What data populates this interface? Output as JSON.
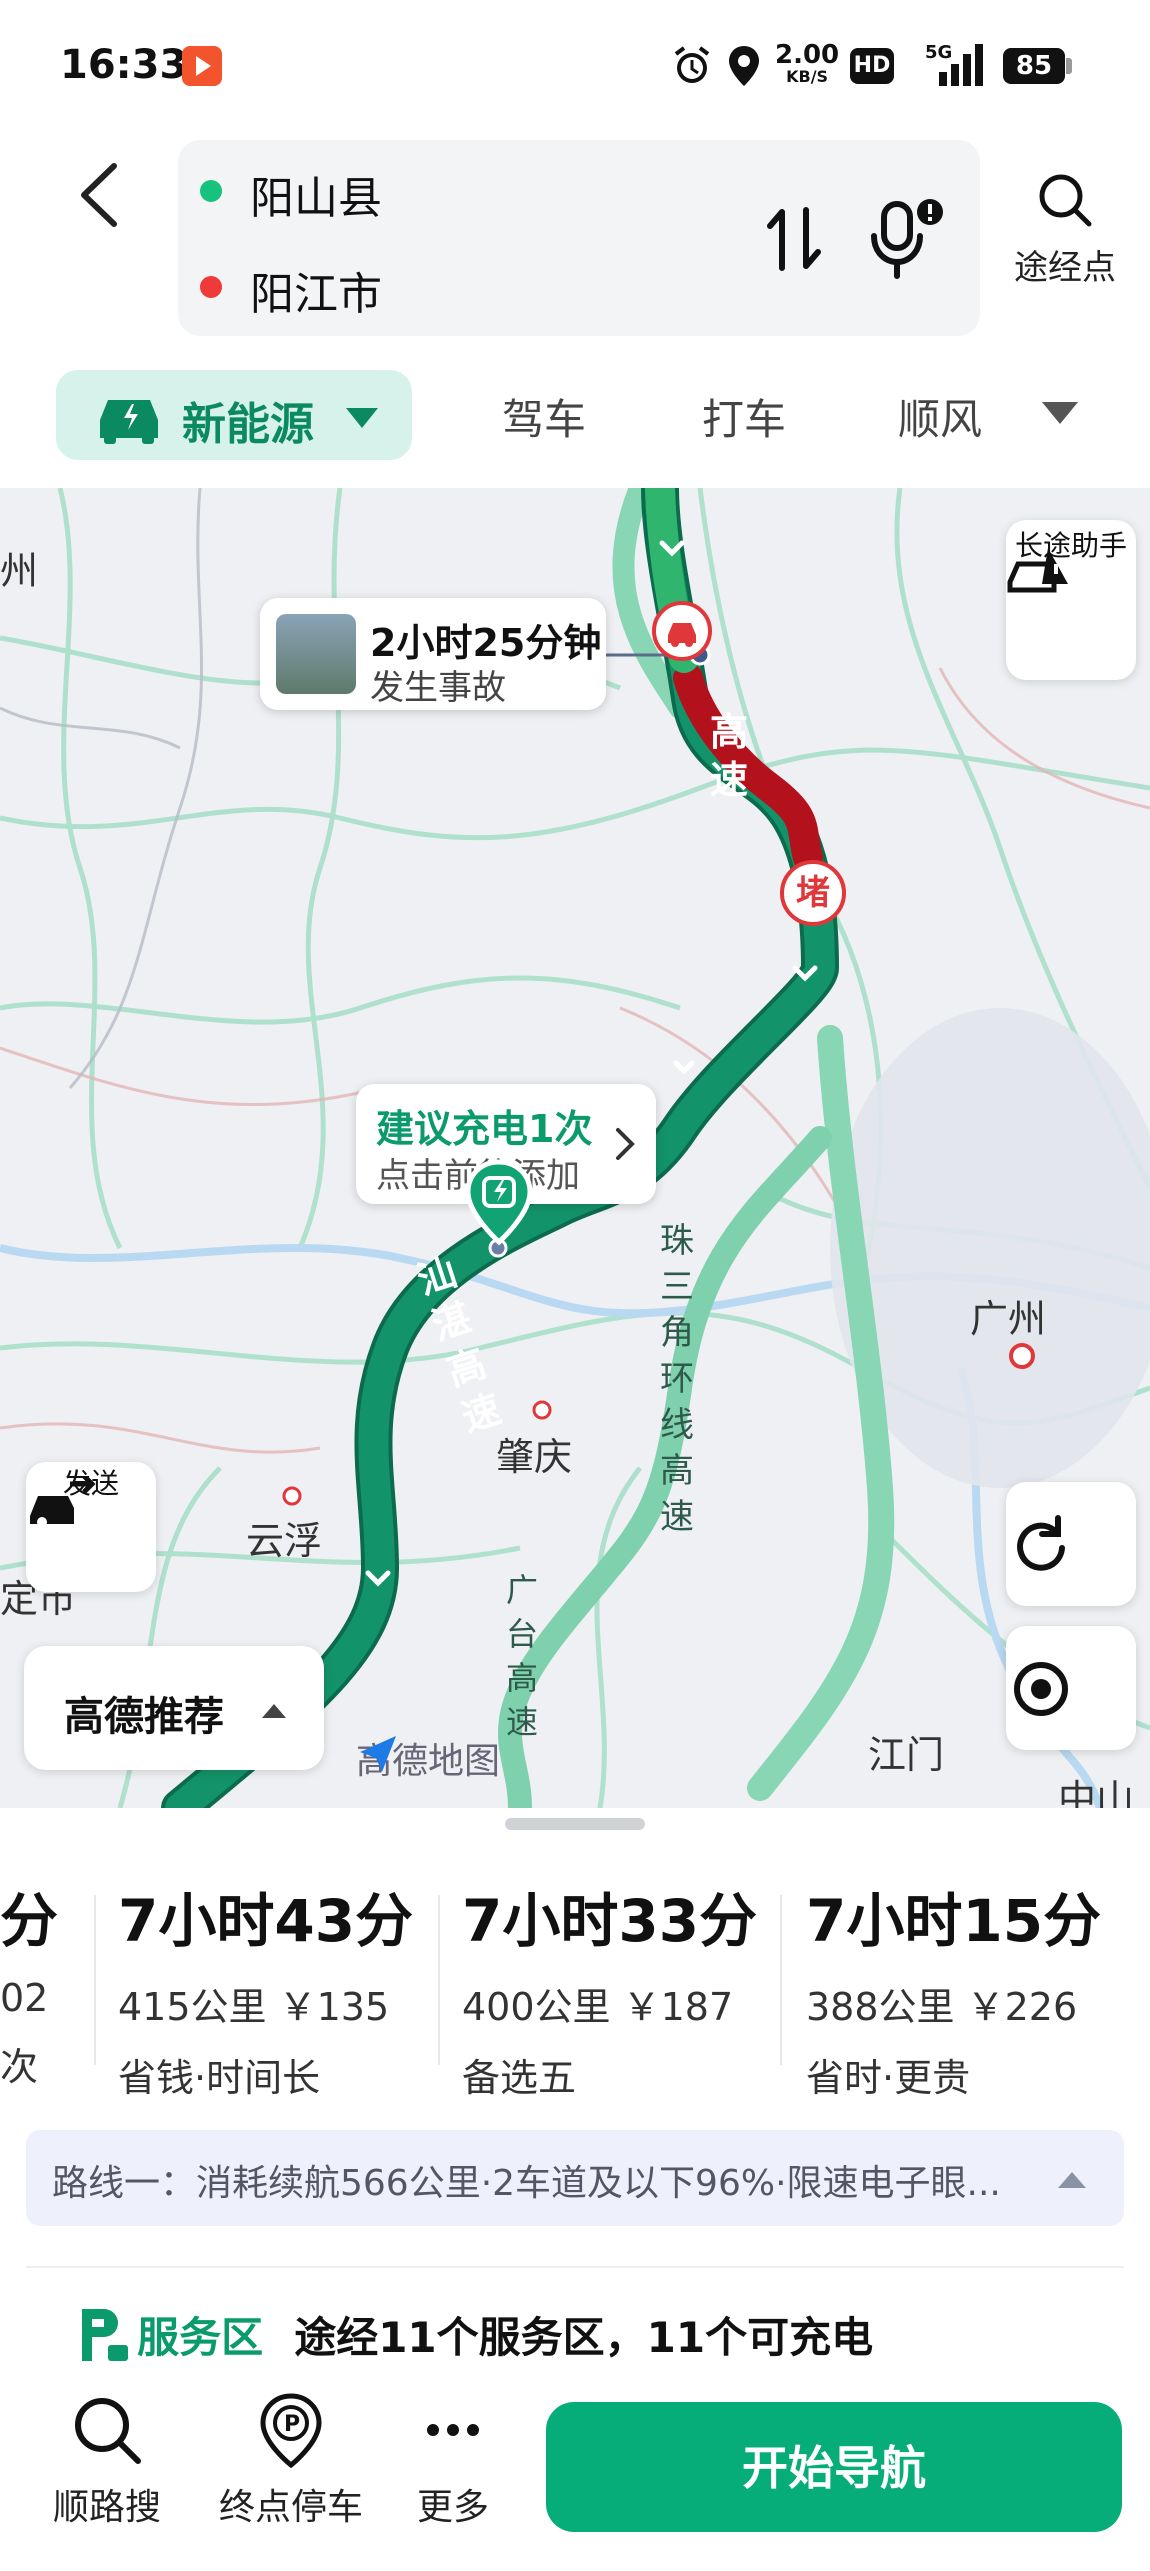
{
  "status_bar": {
    "time": "16:33",
    "speed_value": "2.00",
    "speed_unit": "KB/S",
    "hd": "HD",
    "network": "5G",
    "battery": "85"
  },
  "route_input": {
    "origin": "阳山县",
    "destination": "阳江市",
    "waypoint_label": "途经点"
  },
  "tabs": {
    "active_mode": "新能源",
    "items": [
      "驾车",
      "打车",
      "顺风"
    ]
  },
  "map": {
    "incident": {
      "time": "2小时25分钟",
      "desc": "发生事故"
    },
    "congestion_badge": "堵",
    "charge_card": {
      "title": "建议充电1次",
      "sub": "点击前往添加"
    },
    "long_trip_assistant": "长途助手",
    "send_label": "发送",
    "recommend_label": "高德推荐",
    "watermark": "高德地图",
    "cities": [
      "广州",
      "肇庆",
      "云浮",
      "江门",
      "中山",
      "州",
      "定市"
    ],
    "road_labels": {
      "r1": "汕湛高速",
      "r2": "珠三角环线高速",
      "r3": "广台高速",
      "r4": "高速"
    }
  },
  "routes": [
    {
      "time": "分",
      "distance": "02",
      "tag": "次"
    },
    {
      "time": "7小时43分",
      "distance": "415公里",
      "price": "￥135",
      "tag": "省钱·时间长"
    },
    {
      "time": "7小时33分",
      "distance": "400公里",
      "price": "￥187",
      "tag": "备选五"
    },
    {
      "time": "7小时15分",
      "distance": "388公里",
      "price": "￥226",
      "tag": "省时·更贵"
    }
  ],
  "route_info": "路线一：消耗续航566公里·2车道及以下96%·限速电子眼...",
  "service": {
    "title": "服务区",
    "desc": "途经11个服务区，11个可充电"
  },
  "bottom_bar": {
    "search_along": "顺路搜",
    "dest_parking": "终点停车",
    "more": "更多",
    "start_nav": "开始导航"
  },
  "colors": {
    "brand_green": "#07ad78",
    "route_green": "#0f8a63",
    "congestion_red": "#b3121d",
    "alt_route": "#8fd9b8"
  }
}
